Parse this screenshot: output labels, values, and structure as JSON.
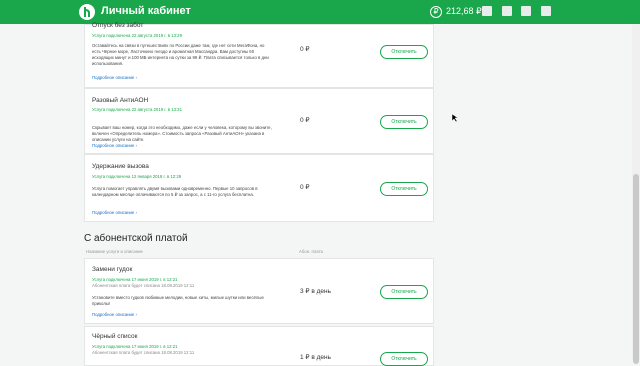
{
  "header": {
    "brand": "Личный кабинет",
    "balance": "212,68 ₽",
    "balance_icon": "₽"
  },
  "colors": {
    "brand": "#1aa74b",
    "link": "#1a6fc4"
  },
  "services_free": [
    {
      "title": "Отпуск без забот",
      "status": "Услуга подключена 22 августа 2019 г. в 13:29",
      "description": "Оставайтесь на связи в путешествиях по России даже там, где нет сети МегаФона, но есть Чёрное море, Ласточкино гнездо и ароматная Массандра. Вам доступны 60 исходящих минут и 100 МБ интернета на сутки за 99 ₽. Плата списывается только в дни использования.",
      "more": "Подробное описание",
      "price": "0 ₽",
      "button": "Отключить"
    },
    {
      "title": "Разовый АнтиАОН",
      "status": "Услуга подключена 22 августа 2019 г. в 13:31",
      "description": "Скрывает ваш номер, когда это необходимо, даже если у человека, которому вы звоните, включен «Определитель номера». Стоимость запроса «Разовый АнтиАОН» указана в описании услуги на сайте.",
      "more": "Подробное описание",
      "price": "0 ₽",
      "button": "Отключить"
    },
    {
      "title": "Удержание вызова",
      "status": "Услуга подключена 12 января 2019 г. в 12:29",
      "description": "Услуга помогает управлять двумя вызовами одновременно. Первые 10 запросов в календарном месяце оплачиваются по 5 ₽ за запрос, а с 11-го услуга бесплатна.",
      "more": "Подробное описание",
      "price": "0 ₽",
      "button": "Отключить"
    }
  ],
  "paid_section": {
    "title": "С абонентской платой",
    "col_name": "Название услуги и описание",
    "col_fee": "Абон. плата"
  },
  "services_paid": [
    {
      "title": "Замени гудок",
      "status": "Услуга подключена 17 июня 2019 г. в 12:21",
      "status_extra": "Абонентская плата будет списана 18.08.2019 12:11",
      "description": "Установите вместо гудков любимые мелодии, новые хиты, милые шутки или весёлые приколы!",
      "more": "Подробное описание",
      "price": "3 ₽ в день",
      "button": "Отключить"
    },
    {
      "title": "Чёрный список",
      "status": "Услуга подключена 17 июня 2019 г. в 12:21",
      "status_extra": "Абонентская плата будет списана 18.08.2019 12:11",
      "price": "1 ₽ в день",
      "button": "Отключить"
    }
  ]
}
